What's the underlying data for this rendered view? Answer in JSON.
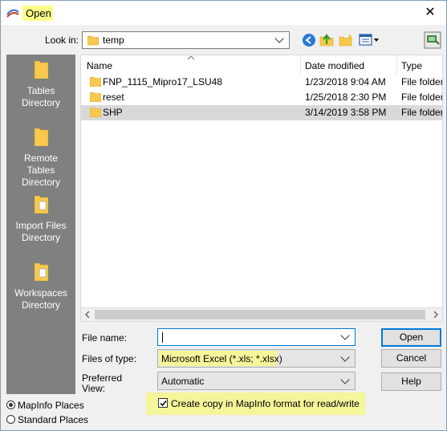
{
  "title": "Open",
  "look_in": {
    "label": "Look in:",
    "value": "temp"
  },
  "places": [
    {
      "label": "Tables Directory",
      "lines": [
        "Tables",
        "Directory"
      ]
    },
    {
      "label": "Remote Tables Directory",
      "lines": [
        "Remote",
        "Tables",
        "Directory"
      ]
    },
    {
      "label": "Import Files Directory",
      "lines": [
        "Import Files",
        "Directory"
      ]
    },
    {
      "label": "Workspaces Directory",
      "lines": [
        "Workspaces",
        "Directory"
      ]
    }
  ],
  "columns": {
    "name": "Name",
    "date": "Date modified",
    "type": "Type"
  },
  "files": [
    {
      "name": "FNP_1115_Mipro17_LSU48",
      "date": "1/23/2018 9:04 AM",
      "type": "File folder"
    },
    {
      "name": "reset",
      "date": "1/25/2018 2:30 PM",
      "type": "File folder"
    },
    {
      "name": "SHP",
      "date": "3/14/2019 3:58 PM",
      "type": "File folder"
    }
  ],
  "form": {
    "file_name_label": "File name:",
    "file_name_value": "",
    "files_of_type_label": "Files of type:",
    "files_of_type_value": "Microsoft Excel (*.xls; *.xlsx)",
    "preferred_view_label_1": "Preferred",
    "preferred_view_label_2": "View:",
    "preferred_view_value": "Automatic",
    "copy_checkbox_label": "Create copy in MapInfo format for read/write",
    "copy_checked": true
  },
  "buttons": {
    "open": "Open",
    "cancel": "Cancel",
    "help": "Help"
  },
  "radios": {
    "mapinfo_places": "MapInfo Places",
    "standard_places": "Standard Places",
    "selected": "mapinfo_places"
  },
  "colors": {
    "highlight": "#f5f59a",
    "title_highlight": "#ffff8a",
    "places_bg": "#808080",
    "folder": "#f7c94c",
    "default_button_border": "#0078d7"
  }
}
